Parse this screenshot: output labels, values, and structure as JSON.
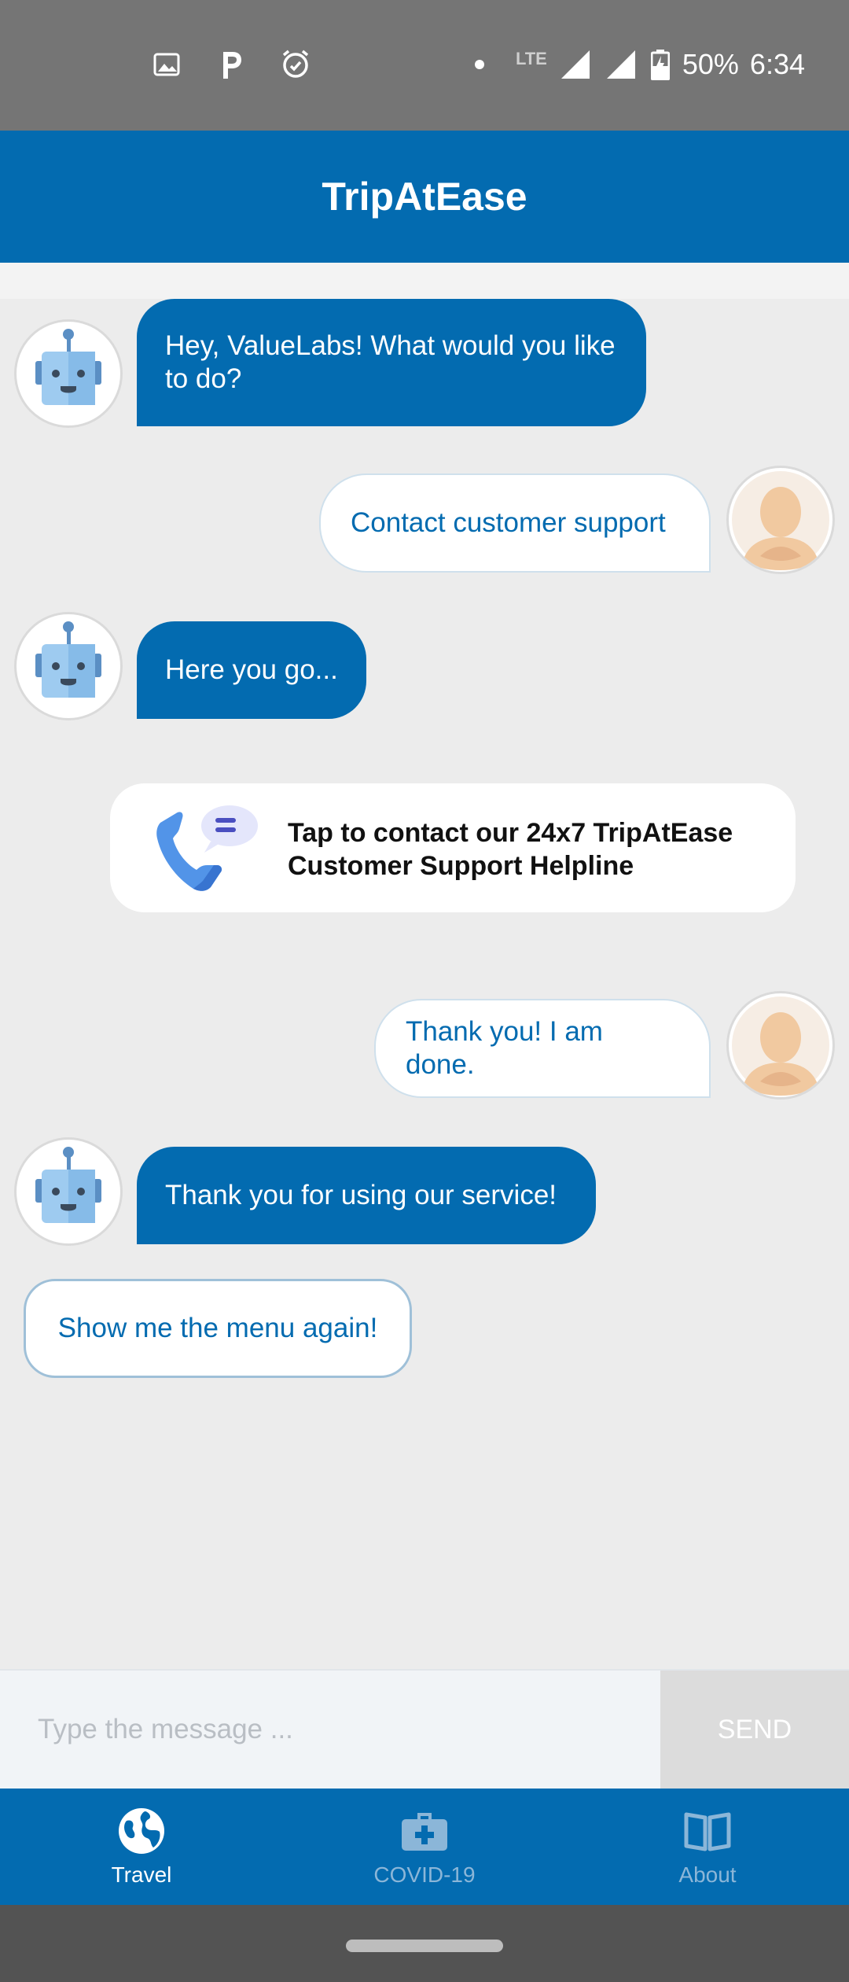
{
  "status_bar": {
    "battery": "50%",
    "time": "6:34",
    "network": "LTE",
    "icons": [
      "image-icon",
      "parking-icon",
      "alarm-icon",
      "dot-icon",
      "signal-icon",
      "signal-icon",
      "battery-icon"
    ]
  },
  "app_bar": {
    "title": "TripAtEase"
  },
  "chat": {
    "messages": [
      {
        "sender": "bot",
        "text": "Hey, ValueLabs! What would you like to do?"
      },
      {
        "sender": "user",
        "text": "Contact customer support"
      },
      {
        "sender": "bot",
        "text": "Here you go..."
      },
      {
        "sender": "bot",
        "type": "card",
        "text": "Tap to contact our 24x7 TripAtEase Customer Support Helpline",
        "icon": "phone-chat-icon"
      },
      {
        "sender": "user",
        "text": "Thank you! I am done."
      },
      {
        "sender": "bot",
        "text": "Thank you for using our service!"
      }
    ],
    "quick_reply": "Show me the menu again!"
  },
  "input": {
    "placeholder": "Type the message ...",
    "value": "",
    "send_label": "SEND"
  },
  "bottom_nav": {
    "items": [
      {
        "label": "Travel",
        "icon": "globe-icon",
        "active": true
      },
      {
        "label": "COVID-19",
        "icon": "medical-kit-icon",
        "active": false
      },
      {
        "label": "About",
        "icon": "book-icon",
        "active": false
      }
    ]
  },
  "colors": {
    "primary": "#036bb0",
    "background": "#ececec",
    "status_bar": "#757575"
  }
}
